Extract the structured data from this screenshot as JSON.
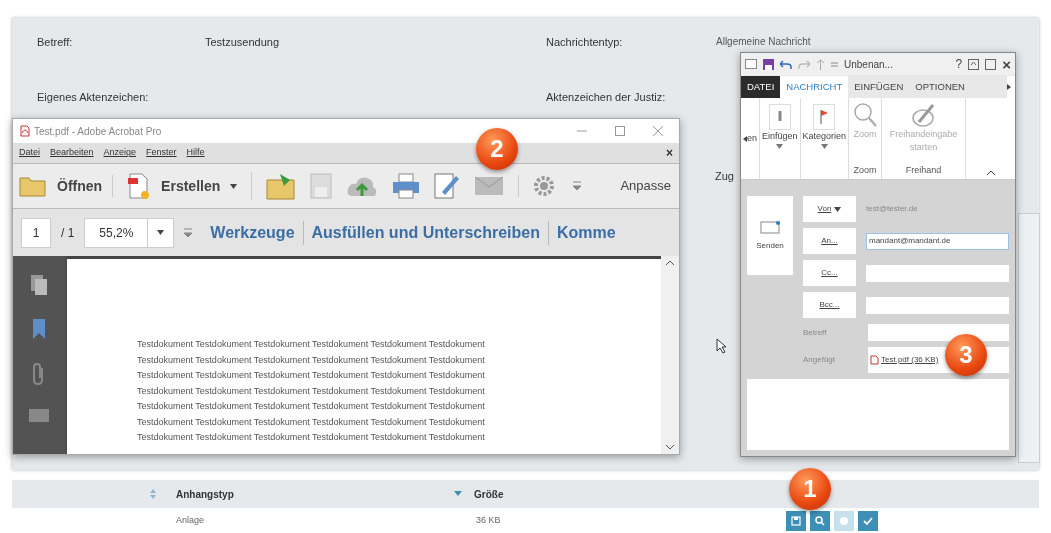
{
  "form": {
    "fields": [
      {
        "label": "Betreff:",
        "value": "Testzusendung"
      },
      {
        "label": "Nachrichtentyp:",
        "value": "Allgemeine Nachricht"
      },
      {
        "label": "Eigenes Aktenzeichen:"
      },
      {
        "label": "Aktenzeichen der Justiz:"
      }
    ],
    "partial_label": "Zug"
  },
  "attachments": {
    "columns": [
      "Anhangstyp",
      "Größe"
    ],
    "rows": [
      {
        "type": "Anlage",
        "size": "36 KB",
        "actions": [
          {
            "kind": "save",
            "disabled": false
          },
          {
            "kind": "search",
            "disabled": false
          },
          {
            "kind": "dot",
            "disabled": true
          },
          {
            "kind": "check",
            "disabled": false
          }
        ]
      }
    ]
  },
  "acrobat": {
    "title": "Test.pdf - Adobe Acrobat Pro",
    "menu": [
      "Datei",
      "Bearbeiten",
      "Anzeige",
      "Fenster",
      "Hilfe"
    ],
    "close_menu": "×",
    "toolbar": {
      "open": "Öffnen",
      "create": "Erstellen",
      "customize": "Anpasse"
    },
    "nav": {
      "page": "1",
      "total": "/ 1",
      "zoom": "55,2%",
      "tabs": [
        "Werkzeuge",
        "Ausfüllen und Unterschreiben",
        "Komme"
      ]
    },
    "document_lines": [
      "Testdokument Testdokument Testdokument Testdokument Testdokument Testdokument",
      "Testdokument Testdokument Testdokument Testdokument Testdokument Testdokument",
      "Testdokument Testdokument Testdokument Testdokument Testdokument Testdokument",
      "Testdokument Testdokument Testdokument Testdokument Testdokument Testdokument",
      "Testdokument Testdokument Testdokument Testdokument Testdokument Testdokument",
      "Testdokument Testdokument Testdokument Testdokument Testdokument Testdokument",
      "Testdokument Testdokument Testdokument Testdokument Testdokument Testdokument"
    ]
  },
  "outlook": {
    "title": "Unbenan...",
    "help": "?",
    "close": "×",
    "file_tab": "DATEI",
    "tabs": [
      {
        "label": "NACHRICHT",
        "selected": true
      },
      {
        "label": "EINFÜGEN",
        "selected": false
      },
      {
        "label": "OPTIONEN",
        "selected": false
      }
    ],
    "ribbon": {
      "partial": "en",
      "insert": "Einfügen",
      "categories": "Kategorien",
      "zoom": "Zoom",
      "zoom_group": "Zoom",
      "ink": "Freihandeingabe starten",
      "ink_group": "Freihand"
    },
    "send": "Senden",
    "from": {
      "button": "Von",
      "value": "test@tester.de"
    },
    "recipients": [
      {
        "button": "An...",
        "value": "mandant@mandant.de"
      },
      {
        "button": "Cc..."
      },
      {
        "button": "Bcc..."
      }
    ],
    "subject_label": "Betreff",
    "attached_label": "Angefügt",
    "attachment": "Test.pdf (36 KB)"
  },
  "badges": [
    "1",
    "2",
    "3"
  ]
}
